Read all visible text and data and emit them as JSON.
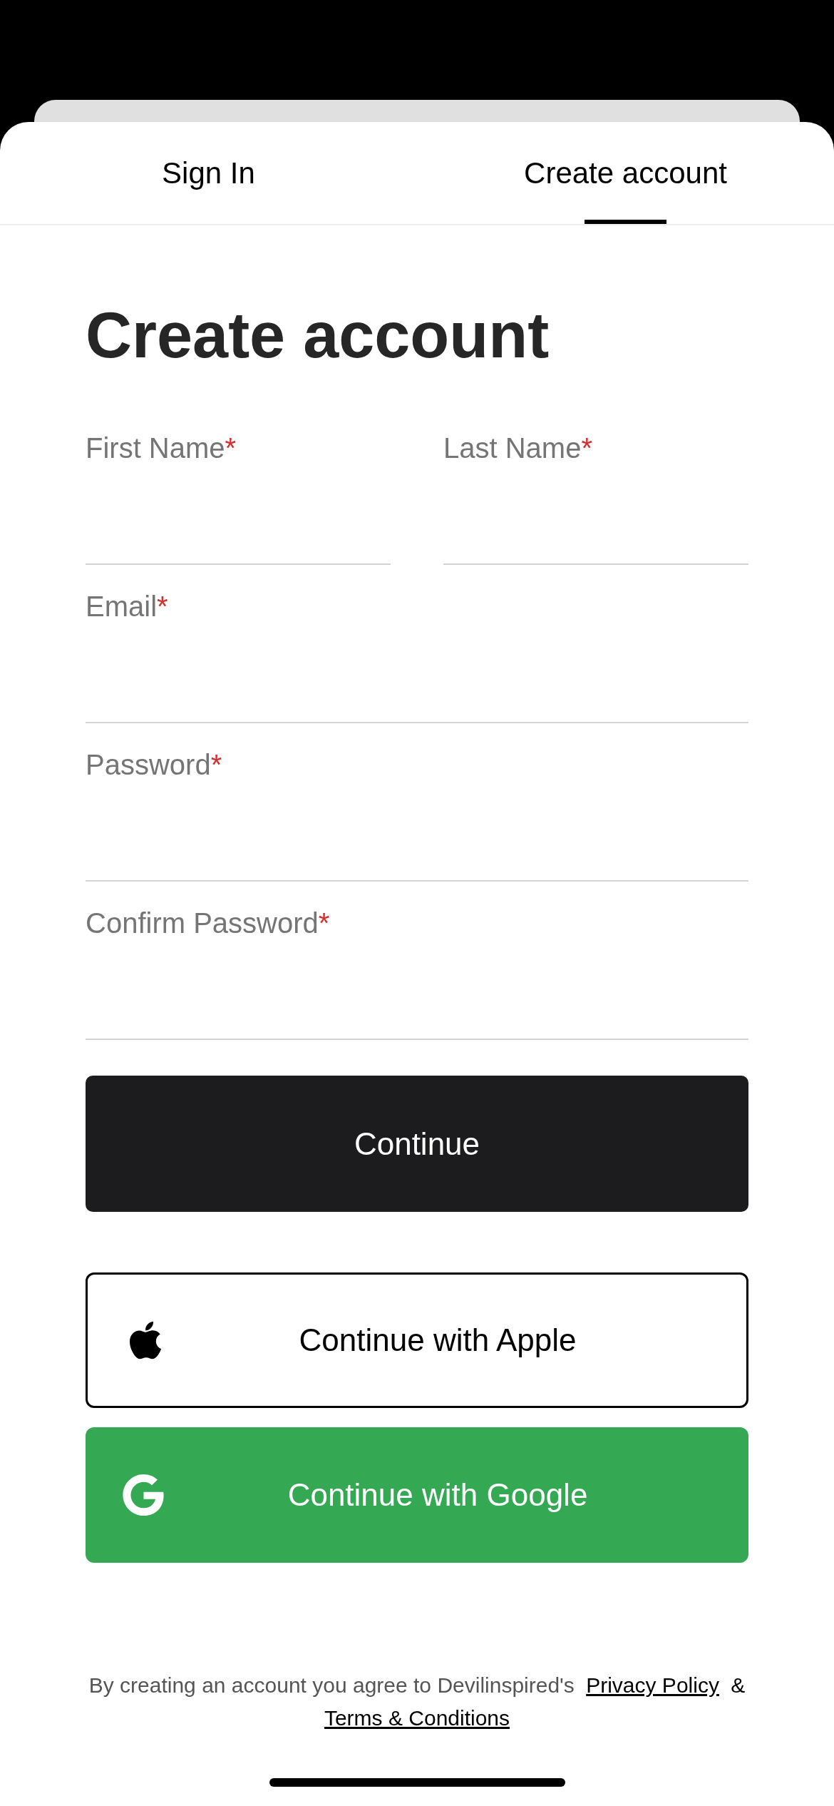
{
  "tabs": [
    {
      "label": "Sign In",
      "selected": false
    },
    {
      "label": "Create account",
      "selected": true
    }
  ],
  "heading": "Create account",
  "form": {
    "rows": [
      {
        "fields": [
          {
            "label": "First Name",
            "required_mark": "*"
          },
          {
            "label": "Last Name",
            "required_mark": "*"
          }
        ]
      },
      {
        "fields": [
          {
            "label": "Email",
            "required_mark": "*"
          }
        ]
      },
      {
        "fields": [
          {
            "label": "Password",
            "required_mark": "*"
          }
        ]
      },
      {
        "fields": [
          {
            "label": "Confirm Password",
            "required_mark": "*"
          }
        ]
      }
    ]
  },
  "primary_button": {
    "label": "Continue"
  },
  "social_buttons": [
    {
      "kind": "apple",
      "label": "Continue with Apple"
    },
    {
      "kind": "google",
      "label": "Continue with Google"
    }
  ],
  "footer": {
    "text": "By creating an account you agree to Devilinspired's",
    "privacy_link": "Privacy Policy",
    "separator": "&",
    "terms_link": "Terms & Conditions"
  }
}
